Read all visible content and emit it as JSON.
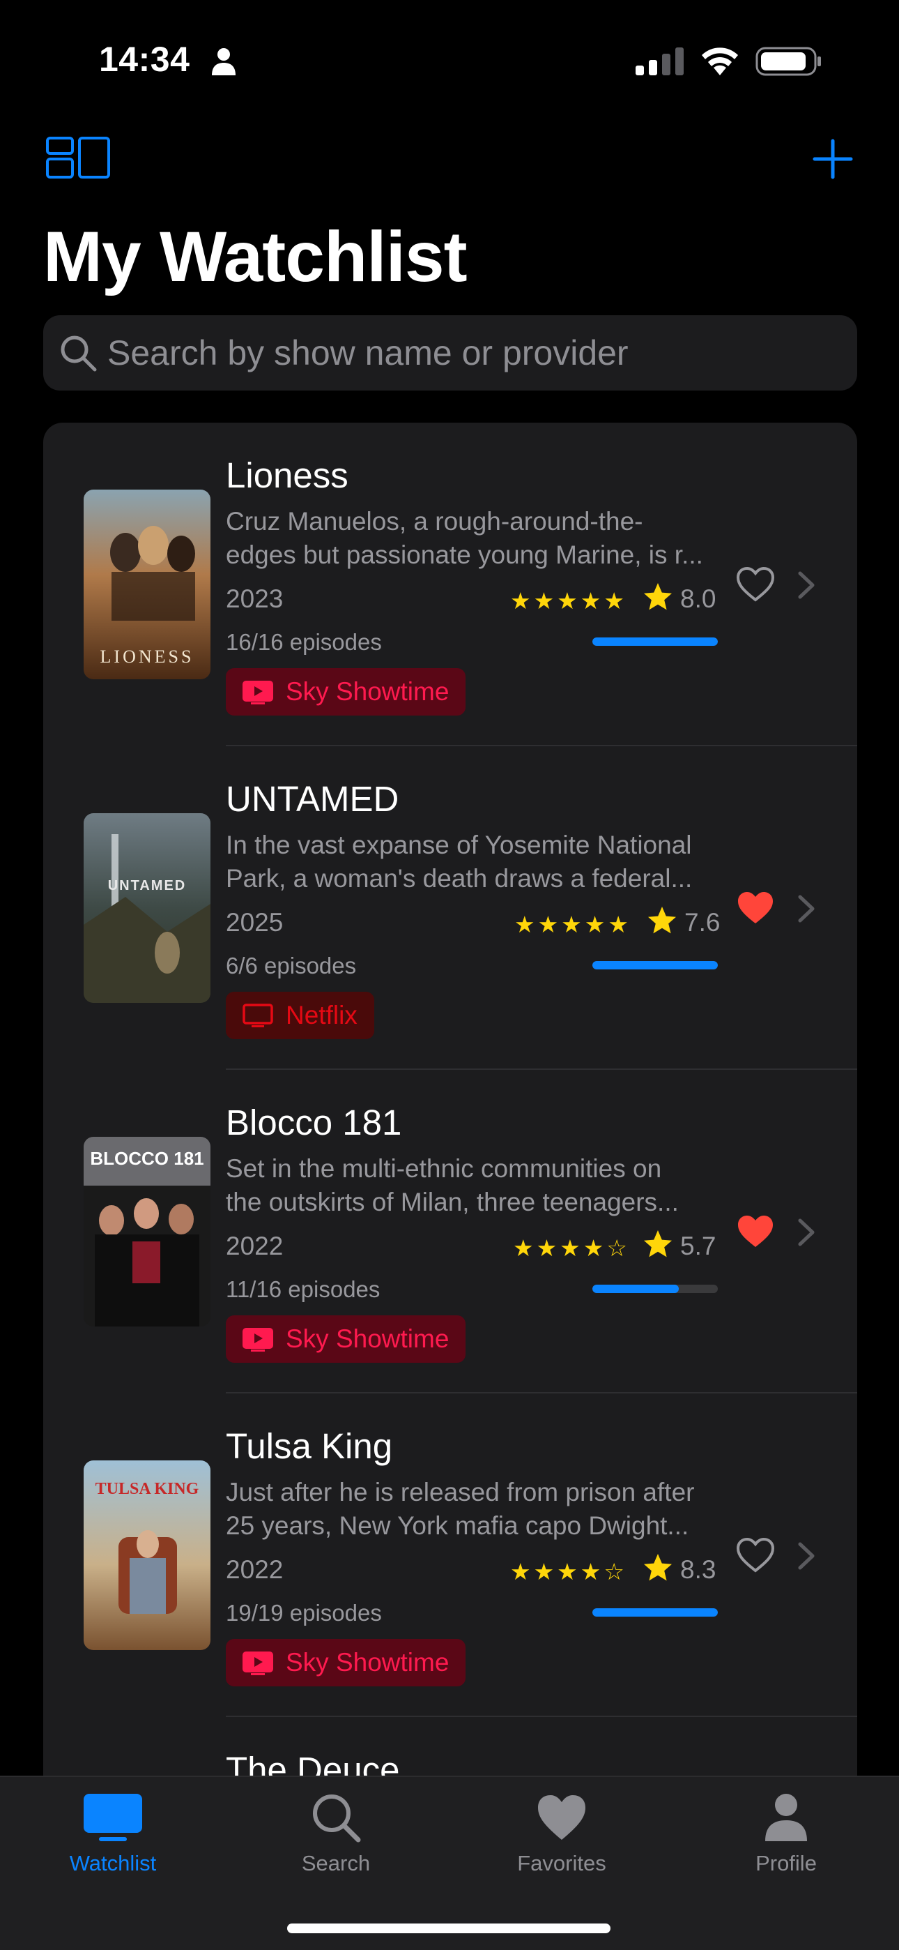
{
  "status_bar": {
    "time": "14:34"
  },
  "header": {
    "title": "My Watchlist",
    "layout_icon": "layout-grid-icon",
    "add_icon": "plus-icon"
  },
  "search": {
    "placeholder": "Search by show name or provider",
    "value": ""
  },
  "colors": {
    "accent": "#0a84ff",
    "star": "#ffd60a",
    "heart": "#ff453a",
    "sky": "#ff1a4f",
    "netflix": "#e50914"
  },
  "shows": [
    {
      "title": "Lioness",
      "desc_line1": "Cruz Manuelos, a rough-around-the-",
      "desc_line2": "edges but passionate young Marine, is r...",
      "year": "2023",
      "stars": "★★★★★",
      "rating": "8.0",
      "episodes": "16/16 episodes",
      "progress": 1.0,
      "provider": "Sky Showtime",
      "favorite": false,
      "poster_text": "LIONESS"
    },
    {
      "title": "UNTAMED",
      "desc_line1": "In the vast expanse of Yosemite National",
      "desc_line2": "Park, a woman's death draws a federal...",
      "year": "2025",
      "stars": "★★★★★",
      "rating": "7.6",
      "episodes": "6/6 episodes",
      "progress": 1.0,
      "provider": "Netflix",
      "favorite": true,
      "poster_text": "UNTAMED"
    },
    {
      "title": "Blocco 181",
      "desc_line1": "Set in the multi-ethnic communities on",
      "desc_line2": "the outskirts of Milan, three teenagers...",
      "year": "2022",
      "stars": "★★★★☆",
      "rating": "5.7",
      "episodes": "11/16 episodes",
      "progress": 0.6875,
      "provider": "Sky Showtime",
      "favorite": true,
      "poster_text": "BLOCCO 181"
    },
    {
      "title": "Tulsa King",
      "desc_line1": "Just after he is released from prison after",
      "desc_line2": "25 years, New York mafia capo Dwight...",
      "year": "2022",
      "stars": "★★★★☆",
      "rating": "8.3",
      "episodes": "19/19 episodes",
      "progress": 1.0,
      "provider": "Sky Showtime",
      "favorite": false,
      "poster_text": "TULSA KING"
    },
    {
      "title": "The Deuce"
    }
  ],
  "tabs": [
    {
      "label": "Watchlist",
      "icon": "tv-icon",
      "active": true
    },
    {
      "label": "Search",
      "icon": "search-icon",
      "active": false
    },
    {
      "label": "Favorites",
      "icon": "heart-icon",
      "active": false
    },
    {
      "label": "Profile",
      "icon": "person-icon",
      "active": false
    }
  ]
}
